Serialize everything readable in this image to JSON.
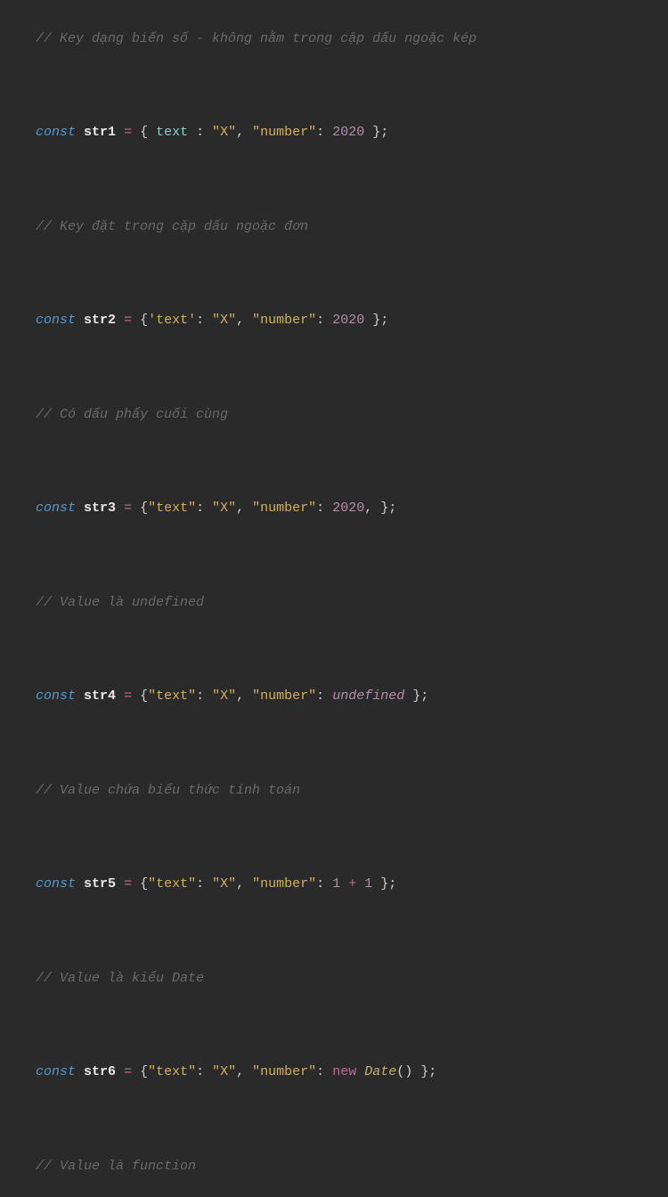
{
  "code": {
    "lines": [
      {
        "type": "comment",
        "text": "// Key dạng biến số - không nằm trong cặp dấu ngoặc kép"
      },
      {
        "type": "code",
        "tokens": {
          "const": "const",
          "var": "str1",
          "eq": " = ",
          "lbrace": "{ ",
          "key1": "text",
          "colon1": " : ",
          "val1": "\"X\"",
          "comma1": ", ",
          "key2": "\"number\"",
          "colon2": ": ",
          "val2": "2020",
          "rbrace": " }",
          "semi": ";"
        }
      },
      {
        "type": "comment",
        "text": "// Key đặt trong cặp dấu ngoặc đơn"
      },
      {
        "type": "code",
        "tokens": {
          "const": "const",
          "var": "str2",
          "eq": " = ",
          "lbrace": "{",
          "key1": "'text'",
          "colon1": ": ",
          "val1": "\"X\"",
          "comma1": ", ",
          "key2": "\"number\"",
          "colon2": ": ",
          "val2": "2020",
          "rbrace": " }",
          "semi": ";"
        }
      },
      {
        "type": "comment",
        "text": "// Có dấu phẩy cuối cùng"
      },
      {
        "type": "code",
        "tokens": {
          "const": "const",
          "var": "str3",
          "eq": " = ",
          "lbrace": "{",
          "key1": "\"text\"",
          "colon1": ": ",
          "val1": "\"X\"",
          "comma1": ", ",
          "key2": "\"number\"",
          "colon2": ": ",
          "val2": "2020",
          "trailcomma": ", ",
          "rbrace": "}",
          "semi": ";"
        }
      },
      {
        "type": "comment",
        "text": "// Value là undefined"
      },
      {
        "type": "code",
        "tokens": {
          "const": "const",
          "var": "str4",
          "eq": " = ",
          "lbrace": "{",
          "key1": "\"text\"",
          "colon1": ": ",
          "val1": "\"X\"",
          "comma1": ", ",
          "key2": "\"number\"",
          "colon2": ": ",
          "val2": "undefined",
          "rbrace": " }",
          "semi": ";"
        }
      },
      {
        "type": "comment",
        "text": "// Value chứa biểu thức tính toán"
      },
      {
        "type": "code",
        "tokens": {
          "const": "const",
          "var": "str5",
          "eq": " = ",
          "lbrace": "{",
          "key1": "\"text\"",
          "colon1": ": ",
          "val1": "\"X\"",
          "comma1": ", ",
          "key2": "\"number\"",
          "colon2": ": ",
          "val2a": "1",
          "plus": " + ",
          "val2b": "1",
          "rbrace": " }",
          "semi": ";"
        }
      },
      {
        "type": "comment",
        "text": "// Value là kiểu Date"
      },
      {
        "type": "code",
        "tokens": {
          "const": "const",
          "var": "str6",
          "eq": " = ",
          "lbrace": "{",
          "key1": "\"text\"",
          "colon1": ": ",
          "val1": "\"X\"",
          "comma1": ", ",
          "key2": "\"number\"",
          "colon2": ": ",
          "newkw": "new",
          "space": " ",
          "classname": "Date",
          "parens": "()",
          "rbrace": " }",
          "semi": ";"
        }
      },
      {
        "type": "comment",
        "text": "// Value là function"
      }
    ]
  }
}
